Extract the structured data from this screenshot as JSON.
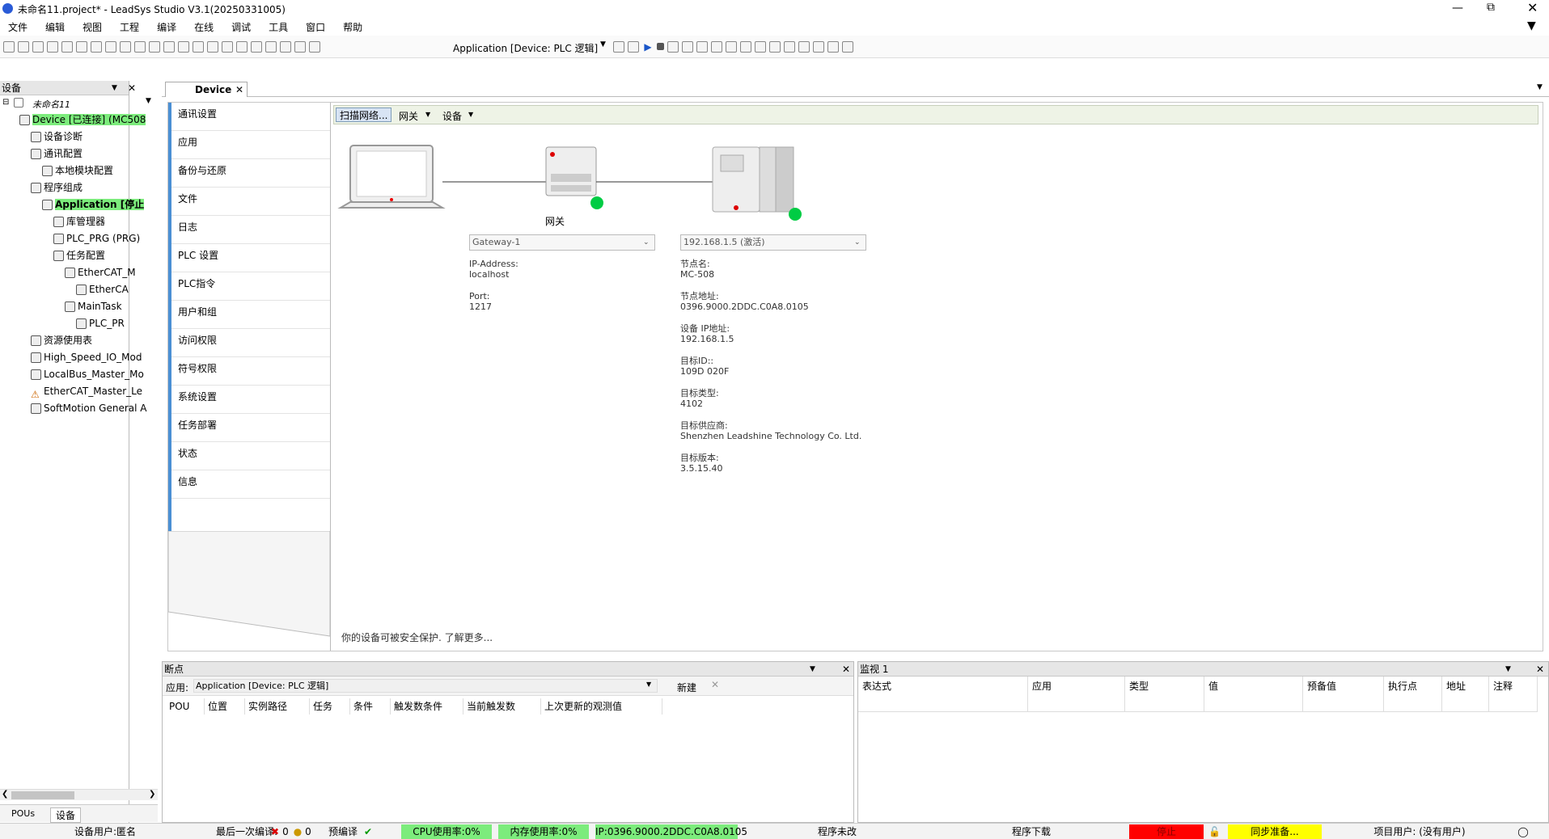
{
  "window": {
    "title": "未命名11.project* - LeadSys Studio V3.1(20250331005)"
  },
  "menu": [
    "文件",
    "编辑",
    "视图",
    "工程",
    "编译",
    "在线",
    "调试",
    "工具",
    "窗口",
    "帮助"
  ],
  "toolbar": {
    "application_selector": "Application [Device: PLC 逻辑]"
  },
  "devices_panel": {
    "title": "设备",
    "project": "未命名11",
    "tree": [
      {
        "label": "Device [已连接] (MC508",
        "level": 1,
        "highlight": true
      },
      {
        "label": "设备诊断",
        "level": 2
      },
      {
        "label": "通讯配置",
        "level": 2
      },
      {
        "label": "本地模块配置",
        "level": 3
      },
      {
        "label": "程序组成",
        "level": 2
      },
      {
        "label": "Application [停止",
        "level": 3,
        "highlight": true,
        "bold": true
      },
      {
        "label": "库管理器",
        "level": 4
      },
      {
        "label": "PLC_PRG (PRG)",
        "level": 4
      },
      {
        "label": "任务配置",
        "level": 4
      },
      {
        "label": "EtherCAT_M",
        "level": 5
      },
      {
        "label": "EtherCA",
        "level": 6
      },
      {
        "label": "MainTask",
        "level": 5
      },
      {
        "label": "PLC_PR",
        "level": 6
      },
      {
        "label": "资源使用表",
        "level": 2
      },
      {
        "label": "High_Speed_IO_Mod",
        "level": 2
      },
      {
        "label": "LocalBus_Master_Mo",
        "level": 2
      },
      {
        "label": "EtherCAT_Master_Le",
        "level": 2,
        "warning": true
      },
      {
        "label": "SoftMotion General A",
        "level": 2
      }
    ],
    "bottom_tabs": [
      "POUs",
      "设备"
    ]
  },
  "editor": {
    "tab": "Device",
    "nav": [
      "通讯设置",
      "应用",
      "备份与还原",
      "文件",
      "日志",
      "PLC 设置",
      "PLC指令",
      "用户和组",
      "访问权限",
      "符号权限",
      "系统设置",
      "任务部署",
      "状态",
      "信息"
    ],
    "comm_toolbar": {
      "scan": "扫描网络...",
      "gateway": "网关",
      "device": "设备"
    },
    "gateway": {
      "label": "网关",
      "select": "Gateway-1",
      "ip_label": "IP-Address:",
      "ip_value": "localhost",
      "port_label": "Port:",
      "port_value": "1217"
    },
    "device": {
      "select": "192.168.1.5 (激活)",
      "fields": [
        {
          "label": "节点名:",
          "value": "MC-508"
        },
        {
          "label": "节点地址:",
          "value": "0396.9000.2DDC.C0A8.0105"
        },
        {
          "label": "设备 IP地址:",
          "value": "192.168.1.5"
        },
        {
          "label": "目标ID::",
          "value": "109D 020F"
        },
        {
          "label": "目标类型:",
          "value": "4102"
        },
        {
          "label": "目标供应商:",
          "value": "Shenzhen Leadshine Technology Co. Ltd."
        },
        {
          "label": "目标版本:",
          "value": "3.5.15.40"
        }
      ]
    },
    "footer_note": "你的设备可被安全保护. 了解更多..."
  },
  "breakpoints": {
    "title": "断点",
    "app_label": "应用:",
    "app_value": "Application [Device: PLC 逻辑]",
    "new_button": "新建",
    "columns": [
      "POU",
      "位置",
      "实例路径",
      "任务",
      "条件",
      "触发数条件",
      "当前触发数",
      "上次更新的观测值"
    ]
  },
  "watch": {
    "title": "监视 1",
    "columns": [
      "表达式",
      "应用",
      "类型",
      "值",
      "预备值",
      "执行点",
      "地址",
      "注释"
    ]
  },
  "statusbar": {
    "user": "设备用户:匿名",
    "last_compile": "最后一次编译:",
    "err_count": "0",
    "warn_count": "0",
    "precompile": "预编译",
    "cpu": "CPU使用率:0%",
    "mem": "内存使用率:0%",
    "ip": "IP:0396.9000.2DDC.C0A8.0105",
    "prog_unchanged": "程序未改",
    "prog_download": "程序下载",
    "stop": "停止",
    "sync": "同步准备...",
    "project_user": "项目用户: (没有用户)"
  },
  "colors": {
    "green": "#7cec7c",
    "red": "#ff0000",
    "yellow": "#ffff00",
    "status_green": "#00cc44"
  }
}
